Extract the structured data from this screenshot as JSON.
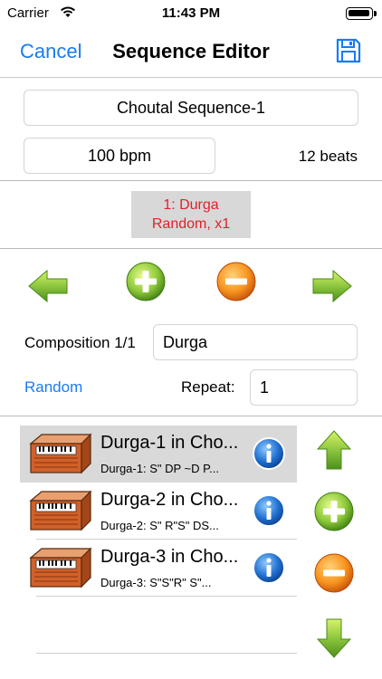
{
  "status": {
    "carrier": "Carrier",
    "time": "11:43 PM"
  },
  "nav": {
    "cancel": "Cancel",
    "title": "Sequence Editor"
  },
  "sequence": {
    "name": "Choutal Sequence-1",
    "bpm": "100 bpm",
    "beats": "12 beats"
  },
  "chip": {
    "line1": "1: Durga",
    "line2": "Random, x1"
  },
  "composition": {
    "label": "Composition 1/1",
    "value": "Durga",
    "mode": "Random",
    "repeat_label": "Repeat:",
    "repeat_value": "1"
  },
  "rows": [
    {
      "title": "Durga-1 in Cho...",
      "subtitle": "Durga-1: S\" DP ~D P...",
      "selected": true
    },
    {
      "title": "Durga-2 in Cho...",
      "subtitle": "Durga-2: S\" R\"S\" DS...",
      "selected": false
    },
    {
      "title": "Durga-3 in Cho...",
      "subtitle": "Durga-3: S\"S\"R\" S\"...",
      "selected": false
    }
  ],
  "colors": {
    "accent": "#1a7bf2",
    "chip_text": "#e3202c",
    "chip_bg": "#d8d8d8",
    "selected_row": "#d9d9d9"
  },
  "icons": [
    "wifi-icon",
    "battery-icon",
    "save-icon",
    "arrow-left-icon",
    "plus-icon",
    "minus-icon",
    "arrow-right-icon",
    "harmonium-icon",
    "info-icon",
    "arrow-up-icon",
    "arrow-down-icon"
  ]
}
